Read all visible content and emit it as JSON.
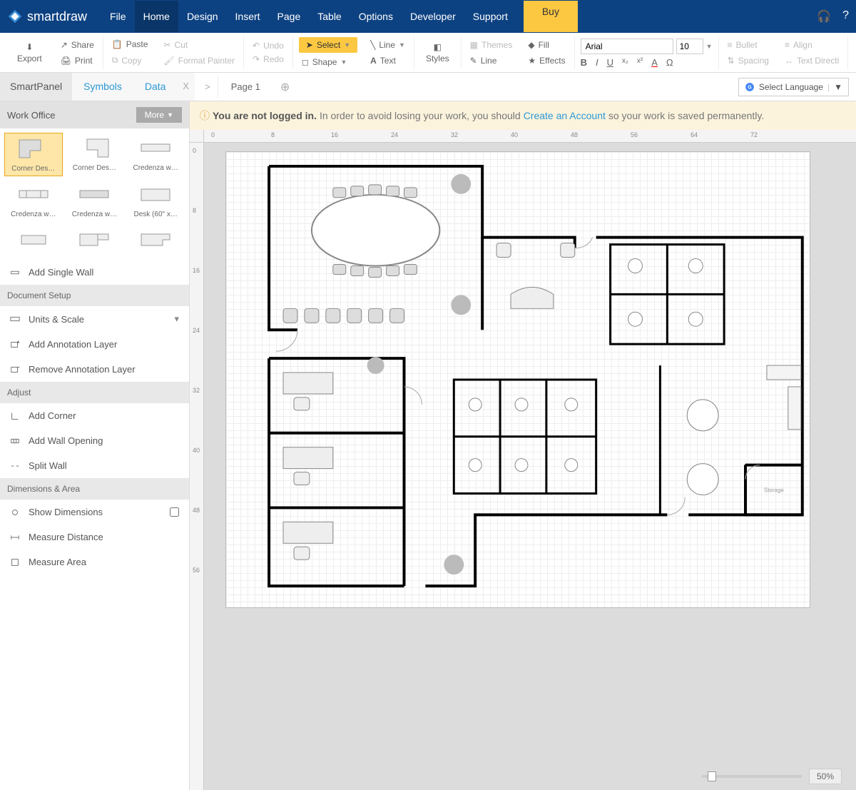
{
  "brand": "smartdraw",
  "menu": {
    "items": [
      "File",
      "Home",
      "Design",
      "Insert",
      "Page",
      "Table",
      "Options",
      "Developer",
      "Support"
    ],
    "active": "Home",
    "buy": "Buy"
  },
  "ribbon": {
    "export": "Export",
    "share": "Share",
    "print": "Print",
    "paste": "Paste",
    "cut": "Cut",
    "copy": "Copy",
    "format_painter": "Format Painter",
    "undo": "Undo",
    "redo": "Redo",
    "select": "Select",
    "line": "Line",
    "shape": "Shape",
    "text": "Text",
    "styles": "Styles",
    "themes": "Themes",
    "fill": "Fill",
    "line2": "Line",
    "effects": "Effects",
    "font": "Arial",
    "font_size": "10",
    "bullet": "Bullet",
    "align": "Align",
    "spacing": "Spacing",
    "text_direction": "Text Directi"
  },
  "tabs": {
    "smartpanel": "SmartPanel",
    "symbols": "Symbols",
    "data": "Data",
    "page": "Page 1",
    "lang": "Select Language"
  },
  "warning": {
    "prefix": "You are not logged in.",
    "mid": " In order to avoid losing your work, you should ",
    "link": "Create an Account",
    "suffix": " so your work is saved permanently."
  },
  "panel": {
    "library": "Work Office",
    "more": "More",
    "symbols": [
      "Corner Des…",
      "Corner Des…",
      "Credenza w…",
      "Credenza w…",
      "Credenza w…",
      "Desk (60\" x…"
    ],
    "add_wall": "Add Single Wall",
    "doc_setup": "Document Setup",
    "units_scale": "Units & Scale",
    "add_anno": "Add Annotation Layer",
    "remove_anno": "Remove Annotation Layer",
    "adjust": "Adjust",
    "add_corner": "Add Corner",
    "add_opening": "Add Wall Opening",
    "split_wall": "Split Wall",
    "dims_area": "Dimensions & Area",
    "show_dims": "Show Dimensions",
    "measure_dist": "Measure Distance",
    "measure_area": "Measure Area"
  },
  "ruler_h": [
    "0",
    "8",
    "16",
    "24",
    "32",
    "40",
    "48",
    "56",
    "64",
    "72"
  ],
  "ruler_v": [
    "0",
    "8",
    "16",
    "24",
    "32",
    "40",
    "48",
    "56"
  ],
  "floorplan_label": "Storage",
  "zoom": "50%"
}
